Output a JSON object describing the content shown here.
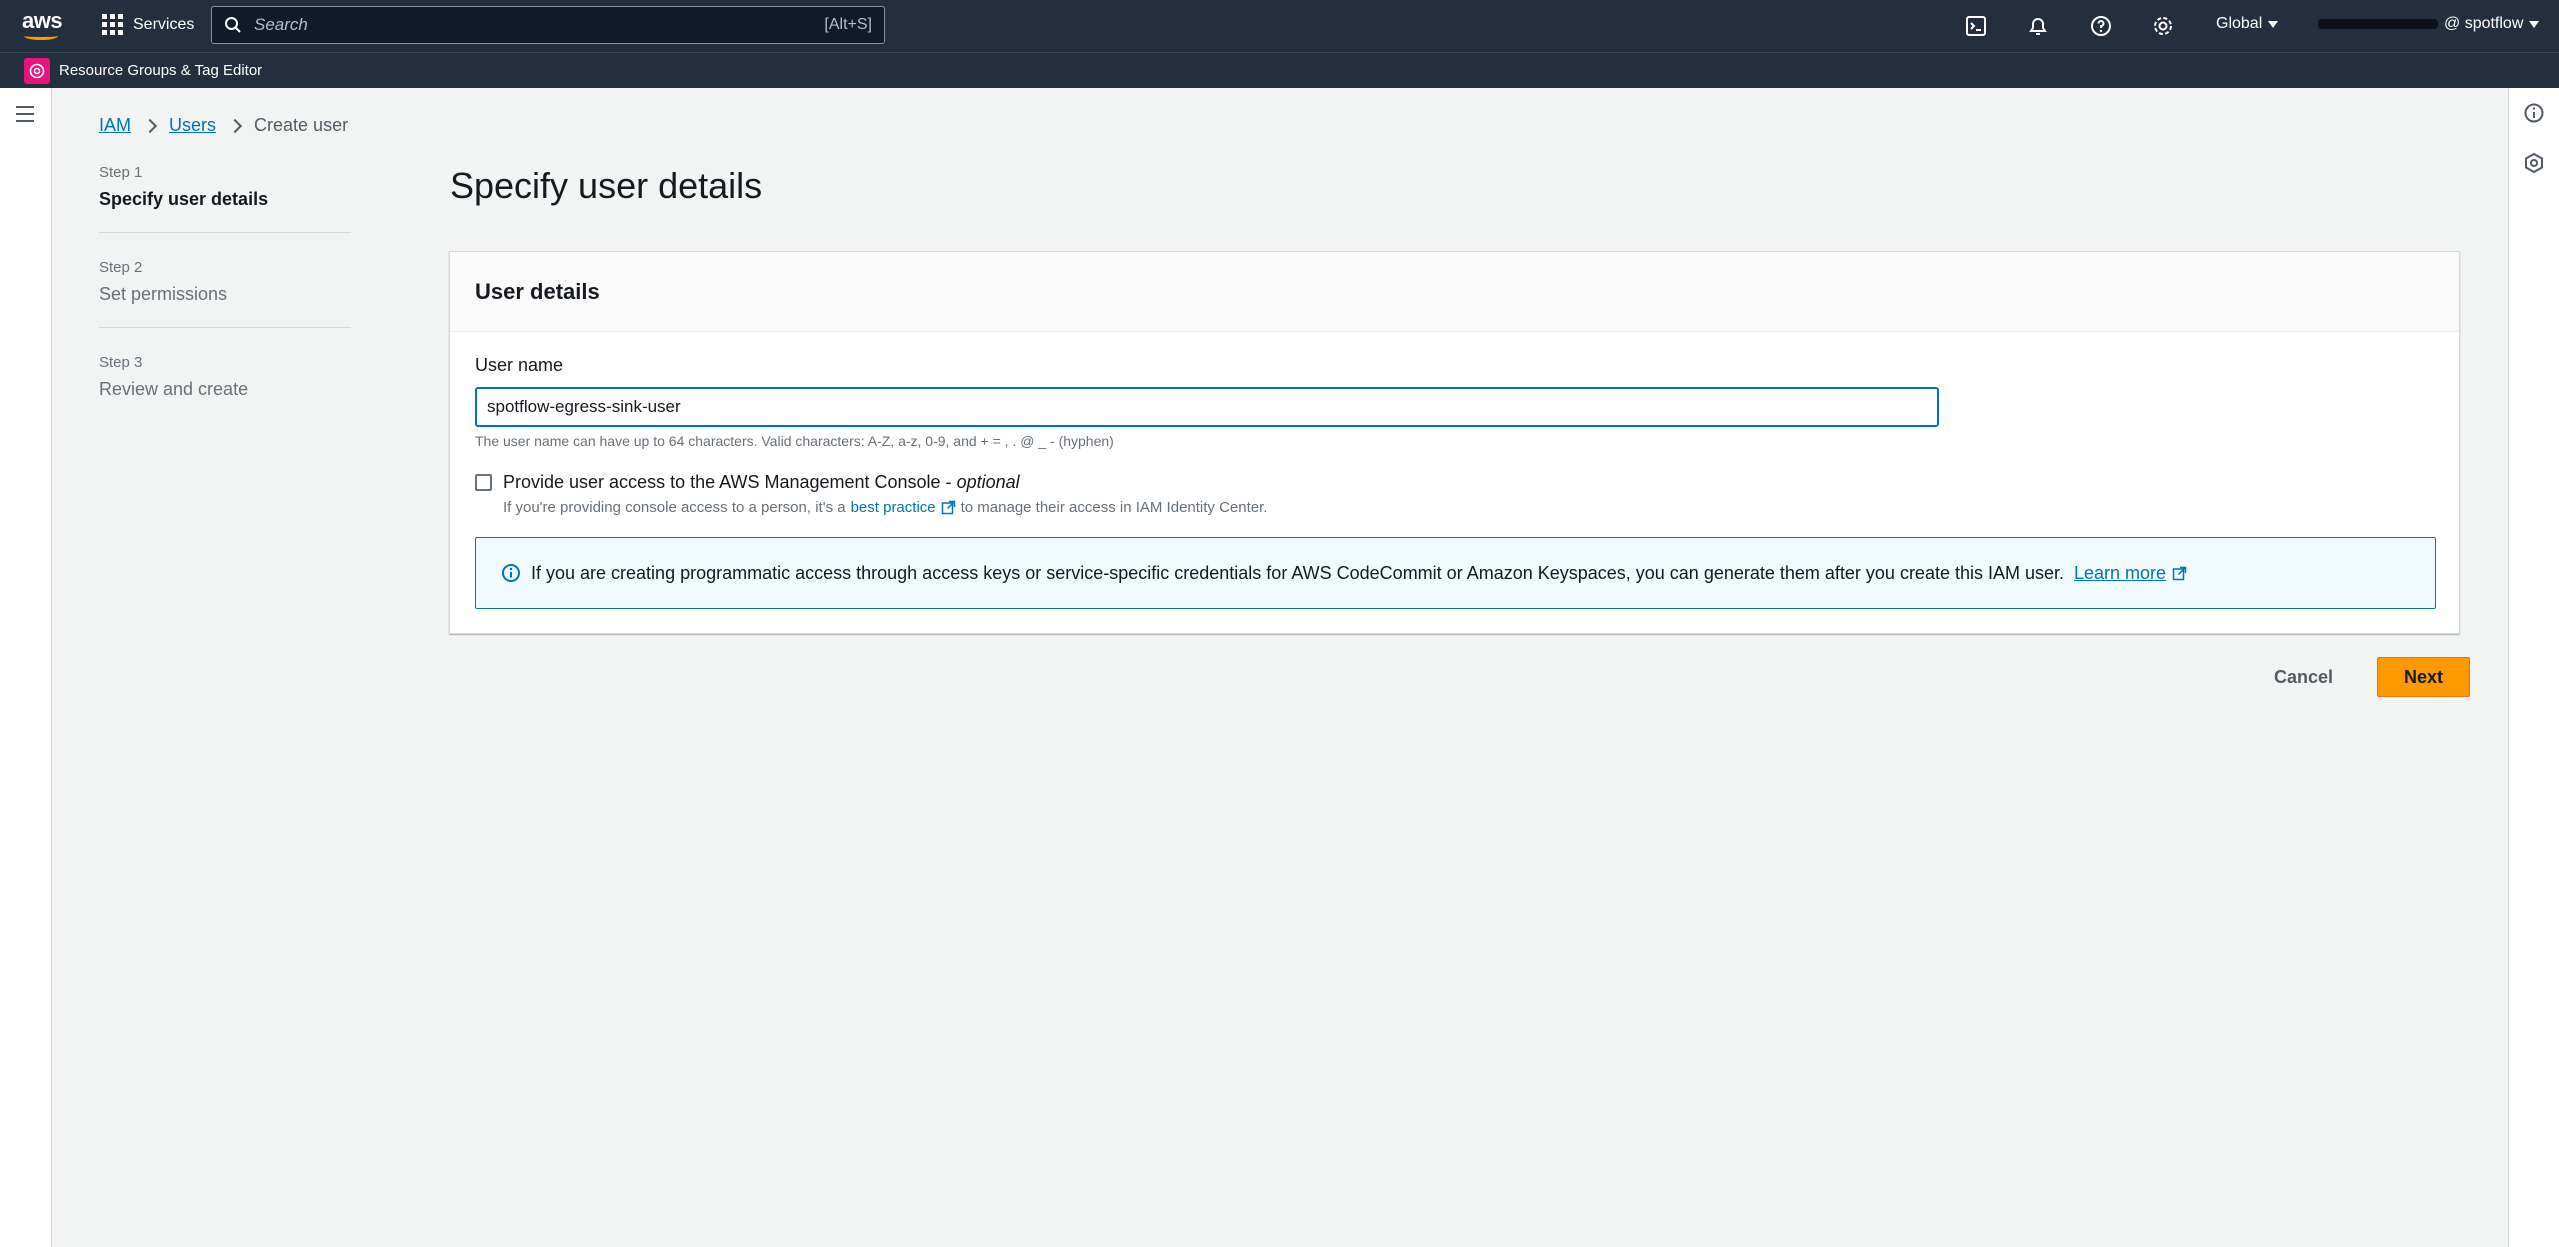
{
  "topnav": {
    "logo": "aws",
    "services_label": "Services",
    "search_placeholder": "Search",
    "search_shortcut": "[Alt+S]",
    "icons": [
      "cloudshell-icon",
      "bell-icon",
      "help-icon",
      "settings-icon"
    ],
    "region": "Global",
    "account": "@ spotflow"
  },
  "subbar": {
    "favorite_label": "Resource Groups & Tag Editor",
    "favorite_color": "#e7157b"
  },
  "breadcrumb": {
    "items": [
      "IAM",
      "Users",
      "Create user"
    ]
  },
  "steps": [
    {
      "num": "Step 1",
      "title": "Specify user details"
    },
    {
      "num": "Step 2",
      "title": "Set permissions"
    },
    {
      "num": "Step 3",
      "title": "Review and create"
    }
  ],
  "main": {
    "title": "Specify user details",
    "panel_title": "User details",
    "user_name_label": "User name",
    "user_name_value": "spotflow-egress-sink-user",
    "constraint": "The user name can have up to 64 characters. Valid characters: A-Z, a-z, 0-9, and + = , . @ _ - (hyphen)",
    "console_access_label": "Provide user access to the AWS Management Console - ",
    "console_access_optional": "optional",
    "console_desc_before": "If you're providing console access to a person, it's a",
    "console_desc_link": "best practice",
    "console_desc_after": "to manage their access in IAM Identity Center.",
    "info_text": "If you are creating programmatic access through access keys or service-specific credentials for AWS CodeCommit or Amazon Keyspaces, you can generate them after you create this IAM user.",
    "info_link": "Learn more"
  },
  "actions": {
    "cancel": "Cancel",
    "next": "Next"
  },
  "colors": {
    "nav_bg": "#232f3e",
    "link": "#0073bb",
    "primary": "#ff9900"
  }
}
